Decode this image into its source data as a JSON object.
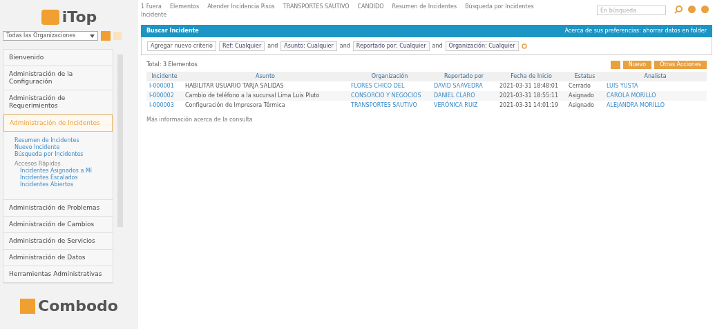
{
  "sidebar": {
    "logo": "iTop",
    "organization": "Todas las Organizaciones",
    "menu": [
      {
        "label": "Bienvenido",
        "selected": false
      },
      {
        "label": "Administración de la Configuración",
        "selected": false
      },
      {
        "label": "Administración de Requerimientos",
        "selected": false
      },
      {
        "label": "Administración de Incidentes",
        "selected": true,
        "children": [
          {
            "label": "Resumen de Incidentes",
            "kind": "link"
          },
          {
            "label": "Nuevo Incidente",
            "kind": "link"
          },
          {
            "label": "Búsqueda por Incidentes",
            "kind": "link"
          },
          {
            "label": "Accesos Rápidos",
            "kind": "heading"
          },
          {
            "label": "Incidentes Asignados a Mí",
            "kind": "sublink"
          },
          {
            "label": "Incidentes Escalados",
            "kind": "sublink"
          },
          {
            "label": "Incidentes Abiertos",
            "kind": "sublink"
          }
        ]
      },
      {
        "label": "Administración de Problemas",
        "selected": false
      },
      {
        "label": "Administración de Cambios",
        "selected": false
      },
      {
        "label": "Administración de Servicios",
        "selected": false
      },
      {
        "label": "Administración de Datos",
        "selected": false
      },
      {
        "label": "Herramientas Administrativas",
        "selected": false
      }
    ],
    "footer_logo": "Combodo"
  },
  "history": [
    "1 Fuera",
    "Elementos",
    "Atender Incidencia Pisos",
    "TRANSPORTES SAUTIVO",
    "CANDIDO",
    "Resumen de Incidentes",
    "Búsqueda por Incidentes",
    "Incidente"
  ],
  "search": {
    "placeholder": "En búsqueda"
  },
  "panel": {
    "title": "Buscar Incidente",
    "notice": "Acerca de sus preferencias: ahorrar datos en folder",
    "criteria": [
      {
        "label": "Agregar nuevo criterio",
        "kind": "add"
      },
      {
        "label": "Ref: Cualquier",
        "kind": "criterion"
      },
      {
        "label": "and",
        "kind": "and"
      },
      {
        "label": "Asunto: Cualquier",
        "kind": "criterion"
      },
      {
        "label": "and",
        "kind": "and"
      },
      {
        "label": "Reportado por: Cualquier",
        "kind": "criterion"
      },
      {
        "label": "and",
        "kind": "and"
      },
      {
        "label": "Organización: Cualquier",
        "kind": "criterion"
      }
    ]
  },
  "results": {
    "total": "Total: 3 Elementos",
    "buttons": [
      "Nuevo",
      "Otras Acciones"
    ],
    "columns": [
      "Incidente",
      "Asunto",
      "Organización",
      "Reportado por",
      "Fecha de Inicio",
      "Estatus",
      "Analista"
    ],
    "rows": [
      [
        "I-000001",
        "HABILITAR USUARIO TARJA SALIDAS",
        "FLORES CHICO DEL",
        "DAVID SAAVEDRA",
        "2021-03-31 18:48:01",
        "Cerrado",
        "LUIS YUSTA"
      ],
      [
        "I-000002",
        "Cambio de teléfono a la sucursal Lima Luis Pluto",
        "CONSORCIO Y NEGOCIOS",
        "DANIEL CLARO",
        "2021-03-31 18:55:11",
        "Asignado",
        "CAROLA MORILLO"
      ],
      [
        "I-000003",
        "Configuración de Impresora Térmica",
        "TRANSPORTES SAUTIVO",
        "VERÓNICA RUIZ",
        "2021-03-31 14:01:19",
        "Asignado",
        "ALEJANDRA MORILLO"
      ]
    ],
    "more": "Más información acerca de la consulta"
  }
}
